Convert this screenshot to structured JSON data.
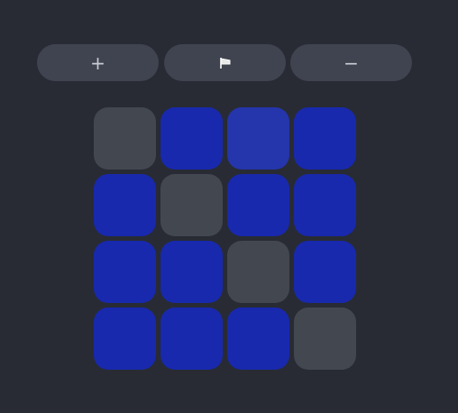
{
  "toolbar": {
    "buttons": [
      {
        "name": "add-button",
        "icon": "plus-icon",
        "glyph": "+"
      },
      {
        "name": "flag-button",
        "icon": "flag-icon",
        "glyph": ""
      },
      {
        "name": "remove-button",
        "icon": "minus-icon",
        "glyph": "−"
      }
    ]
  },
  "board": {
    "rows": 4,
    "cols": 4,
    "cells": [
      [
        "off",
        "on",
        "hot",
        "on"
      ],
      [
        "on",
        "off",
        "on",
        "on"
      ],
      [
        "on",
        "on",
        "off",
        "on"
      ],
      [
        "on",
        "on",
        "on",
        "off"
      ]
    ]
  },
  "colors": {
    "background": "#282b33",
    "button": "#404450",
    "tile_off": "#434750",
    "tile_on": "#1829ad",
    "tile_highlight": "#2535ab"
  }
}
